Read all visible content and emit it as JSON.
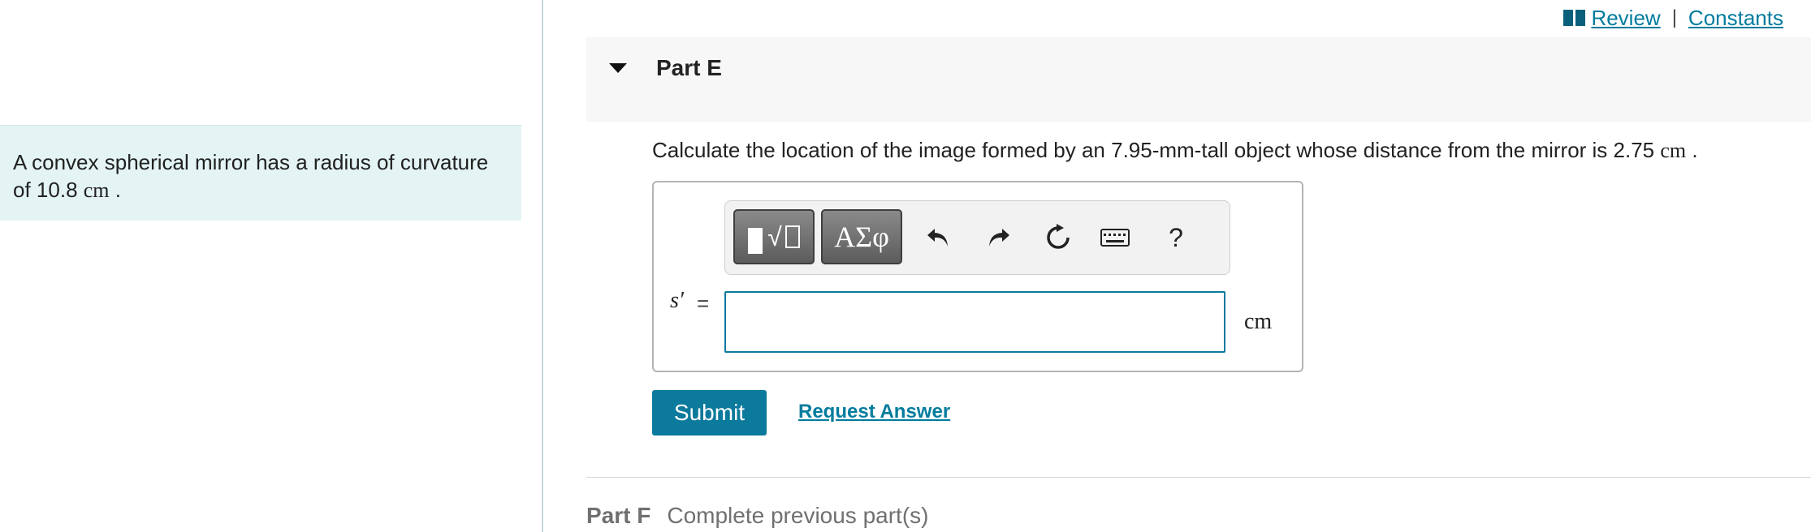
{
  "header": {
    "review_label": "Review",
    "separator": "|",
    "constants_label": "Constants",
    "icon": "book-icon"
  },
  "intro": {
    "text_before": "A convex spherical mirror has a radius of curvature of ",
    "value": "10.8",
    "unit": "cm",
    "text_after": " ."
  },
  "part_e": {
    "title": "Part E",
    "question_before": "Calculate the location of the image formed by an 7.95-mm-tall object whose distance from the mirror is 2.75 ",
    "question_unit": "cm",
    "question_after": " .",
    "toolbar": {
      "greek_label": "ΑΣφ",
      "help_label": "?",
      "icons": [
        "templates-icon",
        "greek-letters-icon",
        "undo-icon",
        "redo-icon",
        "reset-icon",
        "keyboard-icon",
        "help-icon"
      ]
    },
    "variable": "s′",
    "equals": "=",
    "answer_value": "",
    "unit": "cm",
    "submit_label": "Submit",
    "request_label": "Request Answer"
  },
  "part_f": {
    "title": "Part F",
    "status": "Complete previous part(s)"
  },
  "colors": {
    "accent": "#0b7a9c",
    "link": "#007c9e",
    "intro_bg": "#e4f4f4",
    "header_bg": "#f7f7f7"
  }
}
